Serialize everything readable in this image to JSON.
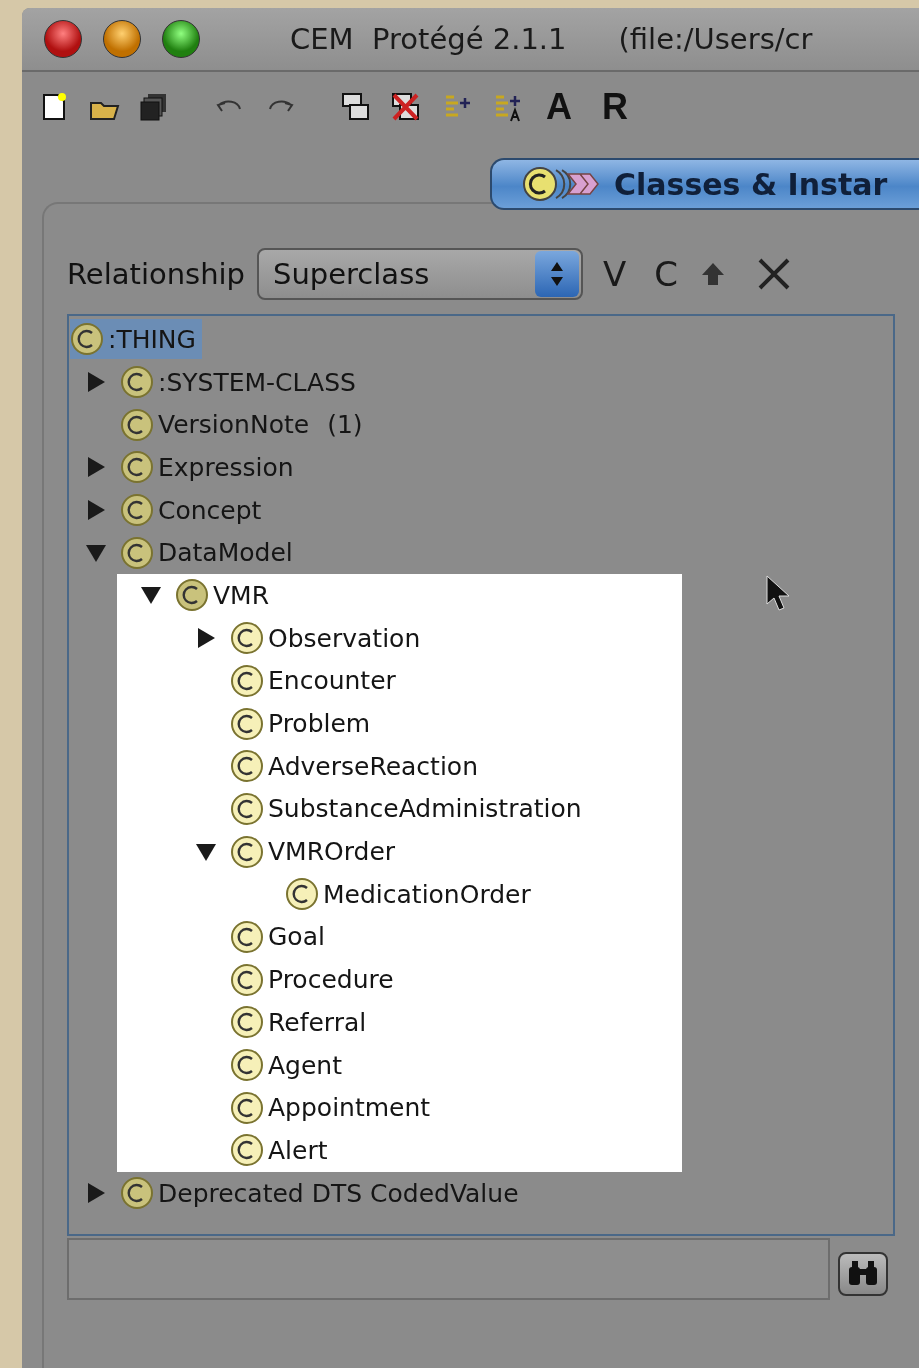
{
  "window": {
    "title": "CEM  Protégé 2.1.1",
    "path": "(file:/Users/cr"
  },
  "toolbar_letters": [
    "A",
    "R"
  ],
  "tab": {
    "label": "Classes & Instar",
    "selected": true
  },
  "relationship": {
    "label": "Relationship",
    "value": "Superclass",
    "letters": [
      "V",
      "C"
    ]
  },
  "tree": [
    {
      "label": ":THING",
      "selected": true,
      "children": [
        {
          "label": ":SYSTEM-CLASS",
          "selected": false,
          "expanded": false
        },
        {
          "label": "VersionNote",
          "count": "(1)",
          "selected": false
        },
        {
          "label": "Expression",
          "selected": false,
          "expanded": false
        },
        {
          "label": "Concept",
          "selected": false,
          "expanded": false
        },
        {
          "label": "DataModel",
          "selected": false,
          "expanded": true,
          "children": [
            {
              "label": "VMR",
              "selected": false,
              "expanded": true,
              "highlighted": true,
              "children": [
                {
                  "label": "Observation",
                  "selected": false,
                  "expanded": false
                },
                {
                  "label": "Encounter",
                  "selected": false
                },
                {
                  "label": "Problem",
                  "selected": false
                },
                {
                  "label": "AdverseReaction",
                  "selected": false
                },
                {
                  "label": "SubstanceAdministration",
                  "selected": false
                },
                {
                  "label": "VMROrder",
                  "selected": false,
                  "expanded": true,
                  "children": [
                    {
                      "label": "MedicationOrder",
                      "selected": false
                    }
                  ]
                },
                {
                  "label": "Goal",
                  "selected": false
                },
                {
                  "label": "Procedure",
                  "selected": false
                },
                {
                  "label": "Referral",
                  "selected": false
                },
                {
                  "label": "Agent",
                  "selected": false
                },
                {
                  "label": "Appointment",
                  "selected": false
                },
                {
                  "label": "Alert",
                  "selected": false
                }
              ]
            }
          ]
        },
        {
          "label": "Deprecated DTS CodedValue",
          "selected": false,
          "expanded": false
        }
      ]
    }
  ]
}
